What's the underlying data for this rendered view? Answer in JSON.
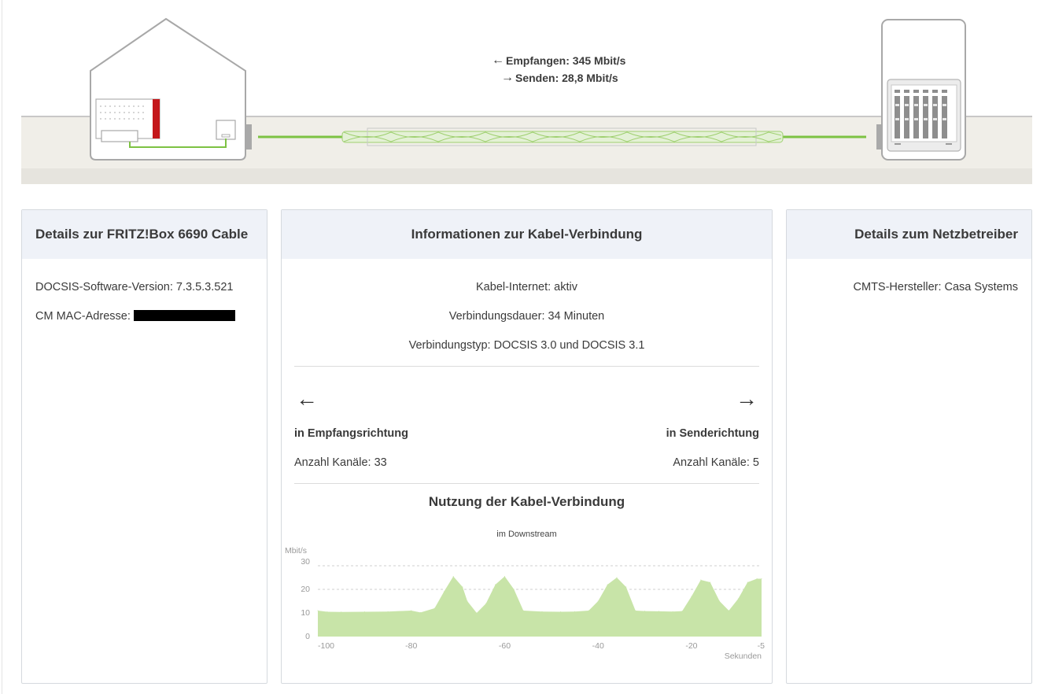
{
  "topology": {
    "receive_label": "Empfangen: 345 Mbit/s",
    "send_label": "Senden: 28,8 Mbit/s",
    "receive_arrow": "←",
    "send_arrow": "→",
    "colors": {
      "cable": "#7dc243",
      "ground": "#f0eee8",
      "outline": "#a8a8a8",
      "router_red": "#c4171b"
    }
  },
  "device_card": {
    "title": "Details zur FRITZ!Box 6690 Cable",
    "docsis_version": "DOCSIS-Software-Version: 7.3.5.3.521",
    "mac_label": "CM MAC-Adresse:"
  },
  "connection_card": {
    "title": "Informationen zur Kabel-Verbindung",
    "status": "Kabel-Internet: aktiv",
    "duration": "Verbindungsdauer: 34 Minuten",
    "type": "Verbindungstyp: DOCSIS 3.0 und DOCSIS 3.1",
    "downstream": {
      "arrow": "←",
      "label": "in Empfangsrichtung",
      "channels": "Anzahl Kanäle: 33"
    },
    "upstream": {
      "arrow": "→",
      "label": "in Senderichtung",
      "channels": "Anzahl Kanäle: 5"
    },
    "usage_title": "Nutzung der Kabel-Verbindung",
    "usage_subtitle": "im Downstream"
  },
  "operator_card": {
    "title": "Details zum Netzbetreiber",
    "cmts": "CMTS-Hersteller: Casa Systems"
  },
  "chart_data": {
    "type": "area",
    "ylabel": "Mbit/s",
    "xlabel": "Sekunden",
    "ylim": [
      0,
      30
    ],
    "xlim": [
      -100,
      -5
    ],
    "yticks": [
      0,
      10,
      20,
      30
    ],
    "xticks": [
      -100,
      -80,
      -60,
      -40,
      -20,
      -5
    ],
    "grid": true,
    "color": "#c8e4a8",
    "x": [
      -100,
      -98,
      -95,
      -90,
      -85,
      -80,
      -78,
      -75,
      -73,
      -71,
      -69,
      -68,
      -66,
      -64,
      -62,
      -60,
      -58,
      -56,
      -52,
      -48,
      -45,
      -42,
      -40,
      -38,
      -36,
      -34,
      -32,
      -30,
      -27,
      -24,
      -22,
      -20,
      -18,
      -16,
      -14,
      -12,
      -10,
      -8,
      -6,
      -5
    ],
    "values": [
      11,
      10.5,
      10.4,
      10.5,
      10.6,
      11,
      10.2,
      12,
      19,
      25.5,
      21,
      15,
      10,
      14,
      22,
      25.5,
      20,
      11,
      10.6,
      10.5,
      10.6,
      11,
      15,
      22,
      25,
      21,
      11,
      10.8,
      10.7,
      10.6,
      10.8,
      17,
      24,
      23,
      15,
      11,
      16,
      23,
      24.5,
      24.5
    ]
  }
}
